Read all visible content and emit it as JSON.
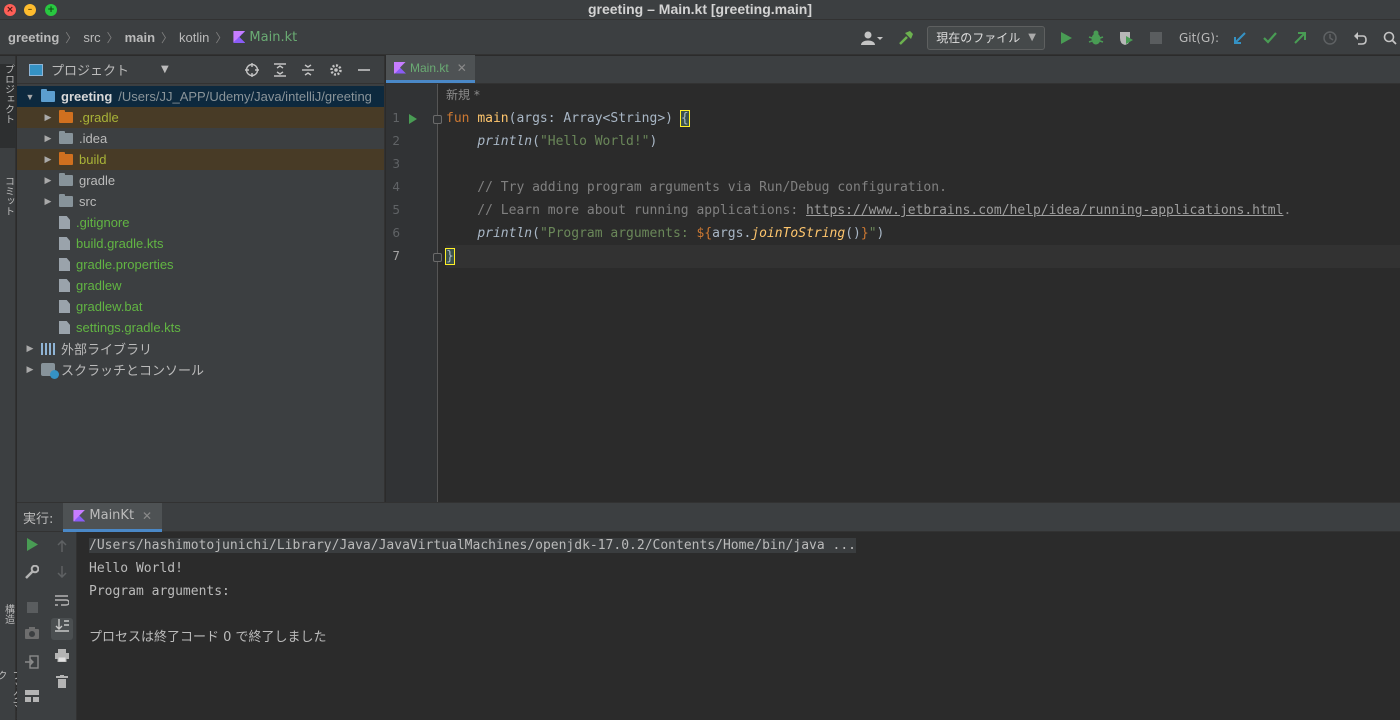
{
  "window": {
    "title": "greeting – Main.kt [greeting.main]"
  },
  "breadcrumb": [
    {
      "label": "greeting",
      "bold": true
    },
    {
      "label": "src",
      "bold": false
    },
    {
      "label": "main",
      "bold": true
    },
    {
      "label": "kotlin",
      "bold": false
    }
  ],
  "breadcrumb_file": "Main.kt",
  "toolbar": {
    "run_config": "現在のファイル",
    "git_label": "Git(G):"
  },
  "left_strip": {
    "project": "プロジェクト",
    "commit": "コミット",
    "structure": "構造",
    "bookmarks": "ブックマーク"
  },
  "project_panel": {
    "title": "プロジェクト",
    "root_name": "greeting",
    "root_path": "/Users/JJ_APP/Udemy/Java/intelliJ/greeting",
    "items": [
      {
        "label": ".gradle",
        "type": "folder",
        "color": "orange",
        "expandable": true,
        "excluded": true
      },
      {
        "label": ".idea",
        "type": "folder",
        "color": "gray",
        "expandable": true,
        "excluded": false
      },
      {
        "label": "build",
        "type": "folder",
        "color": "orange",
        "expandable": true,
        "excluded": true
      },
      {
        "label": "gradle",
        "type": "folder",
        "color": "gray",
        "expandable": true,
        "excluded": false
      },
      {
        "label": "src",
        "type": "folder",
        "color": "gray",
        "expandable": true,
        "excluded": false
      },
      {
        "label": ".gitignore",
        "type": "file",
        "expandable": false
      },
      {
        "label": "build.gradle.kts",
        "type": "file",
        "expandable": false
      },
      {
        "label": "gradle.properties",
        "type": "file",
        "expandable": false
      },
      {
        "label": "gradlew",
        "type": "file",
        "expandable": false
      },
      {
        "label": "gradlew.bat",
        "type": "file",
        "expandable": false
      },
      {
        "label": "settings.gradle.kts",
        "type": "file",
        "expandable": false
      }
    ],
    "external_libraries": "外部ライブラリ",
    "scratches": "スクラッチとコンソール"
  },
  "editor": {
    "tab_label": "Main.kt",
    "hint": "新規 *",
    "line_numbers": [
      "1",
      "2",
      "3",
      "4",
      "5",
      "6",
      "7"
    ],
    "code": {
      "l1_fun": "fun ",
      "l1_name": "main",
      "l1_params": "(args: Array<String>) ",
      "l1_brace": "{",
      "l2_indent": "    ",
      "l2_call": "println",
      "l2_open": "(",
      "l2_str": "\"Hello World!\"",
      "l2_close": ")",
      "l4_comment": "    // Try adding program arguments via Run/Debug configuration.",
      "l5_comment": "    // Learn more about running applications: ",
      "l5_link": "https://www.jetbrains.com/help/idea/running-applications.html",
      "l5_end": ".",
      "l6_indent": "    ",
      "l6_call": "println",
      "l6_open": "(",
      "l6_str1": "\"Program arguments: ",
      "l6_tmpl_open": "${",
      "l6_args": "args.",
      "l6_join": "joinToString",
      "l6_parens": "()",
      "l6_tmpl_close": "}",
      "l6_str2": "\"",
      "l6_close": ")",
      "l7_brace": "}"
    }
  },
  "run_panel": {
    "label": "実行:",
    "tab": "MainKt",
    "console": [
      "/Users/hashimotojunichi/Library/Java/JavaVirtualMachines/openjdk-17.0.2/Contents/Home/bin/java ...",
      "Hello World!",
      "Program arguments: ",
      "",
      "プロセスは終了コード 0 で終了しました"
    ]
  },
  "colors": {
    "accent": "#4a88c7",
    "run_green": "#499c54",
    "keyword": "#cc7832",
    "string": "#6a8759",
    "function": "#ffc66d"
  }
}
